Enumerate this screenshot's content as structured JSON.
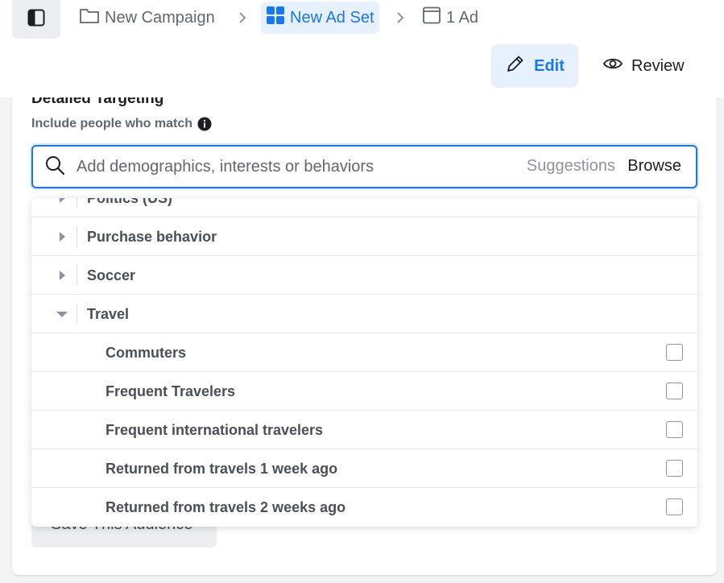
{
  "breadcrumb": {
    "campaign": "New Campaign",
    "adset": "New Ad Set",
    "ad": "1 Ad"
  },
  "toolbar": {
    "edit_label": "Edit",
    "review_label": "Review"
  },
  "targeting": {
    "section_title": "Detailed Targeting",
    "include_label": "Include people who match",
    "search_placeholder": "Add demographics, interests or behaviors",
    "suggestions_label": "Suggestions",
    "browse_label": "Browse",
    "save_audience_label": "Save This Audience"
  },
  "dropdown": {
    "categories": [
      {
        "label": "Politics (US)",
        "expanded": false
      },
      {
        "label": "Purchase behavior",
        "expanded": false
      },
      {
        "label": "Soccer",
        "expanded": false
      },
      {
        "label": "Travel",
        "expanded": true
      }
    ],
    "travel_items": [
      {
        "label": "Commuters",
        "checked": false
      },
      {
        "label": "Frequent Travelers",
        "checked": false
      },
      {
        "label": "Frequent international travelers",
        "checked": false
      },
      {
        "label": "Returned from travels 1 week ago",
        "checked": false
      },
      {
        "label": "Returned from travels 2 weeks ago",
        "checked": false
      }
    ]
  },
  "colors": {
    "accent": "#1877f2",
    "accent_light": "#e7f0fd",
    "text_muted": "#606770"
  },
  "icons": {
    "sidebar_toggle": "sidebar-toggle-icon",
    "campaign": "folder-icon",
    "adset": "grid-icon",
    "ad": "ad-frame-icon",
    "edit": "pencil-icon",
    "review": "eye-icon",
    "search": "search-icon",
    "info": "info-icon"
  }
}
